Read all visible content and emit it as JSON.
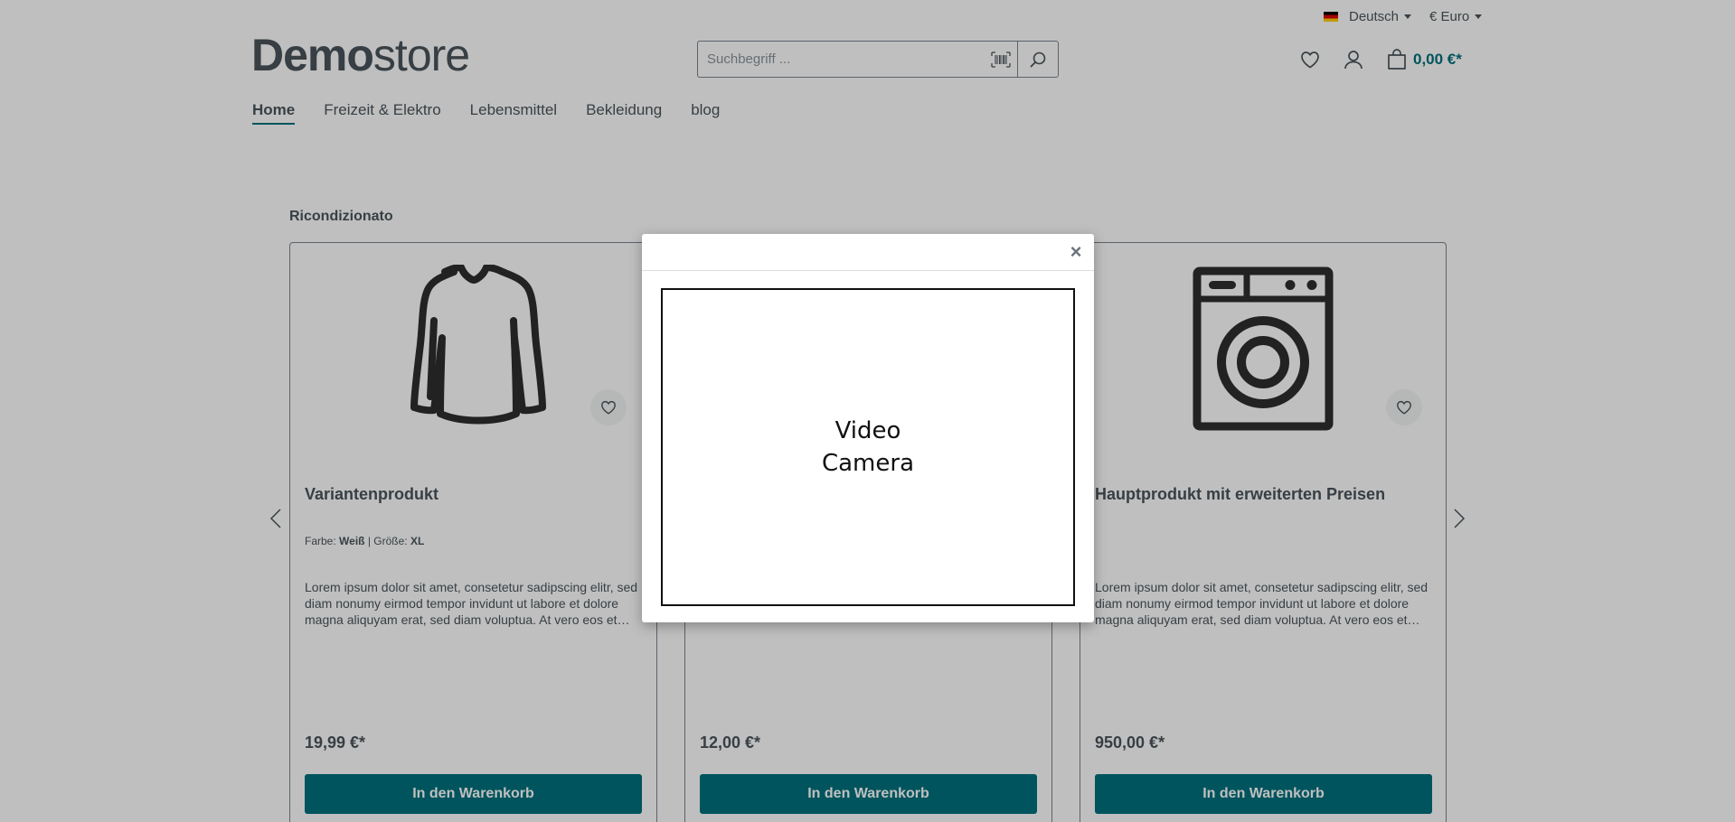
{
  "topbar": {
    "language": "Deutsch",
    "currency": "€ Euro"
  },
  "header": {
    "logo_bold": "Demo",
    "logo_light": "store",
    "search_placeholder": "Suchbegriff ...",
    "cart_total": "0,00 €*"
  },
  "nav": {
    "items": [
      {
        "label": "Home",
        "active": true
      },
      {
        "label": "Freizeit & Elektro",
        "active": false
      },
      {
        "label": "Lebensmittel",
        "active": false
      },
      {
        "label": "Bekleidung",
        "active": false
      },
      {
        "label": "blog",
        "active": false
      }
    ]
  },
  "section": {
    "title": "Ricondizionato"
  },
  "products": [
    {
      "title": "Variantenprodukt",
      "variant_color_label": "Farbe:",
      "variant_color_value": "Weiß",
      "variant_separator": "|",
      "variant_size_label": "Größe:",
      "variant_size_value": "XL",
      "description": "Lorem ipsum dolor sit amet, consetetur sadipscing elitr, sed diam nonumy eirmod tempor invidunt ut labore et dolore magna aliquyam erat, sed diam voluptua. At vero eos et accusam et justo duo dolores et ea rebum.",
      "price": "19,99 €*",
      "button": "In den Warenkorb",
      "image_icon": "shirt-icon"
    },
    {
      "title": "",
      "description": "",
      "price": "12,00 €*",
      "button": "In den Warenkorb",
      "image_icon": ""
    },
    {
      "title": "Hauptprodukt mit erweiterten Preisen",
      "description": "Lorem ipsum dolor sit amet, consetetur sadipscing elitr, sed diam nonumy eirmod tempor invidunt ut labore et dolore magna aliquyam erat, sed diam voluptua. At vero eos et accusam et justo duo dolores et ea rebum.",
      "price": "950,00 €*",
      "button": "In den Warenkorb",
      "image_icon": "washing-machine-icon"
    }
  ],
  "modal": {
    "close": "×",
    "video_label_line1": "Video",
    "video_label_line2": "Camera"
  },
  "colors": {
    "accent": "#00707d",
    "text": "#4a545b"
  }
}
